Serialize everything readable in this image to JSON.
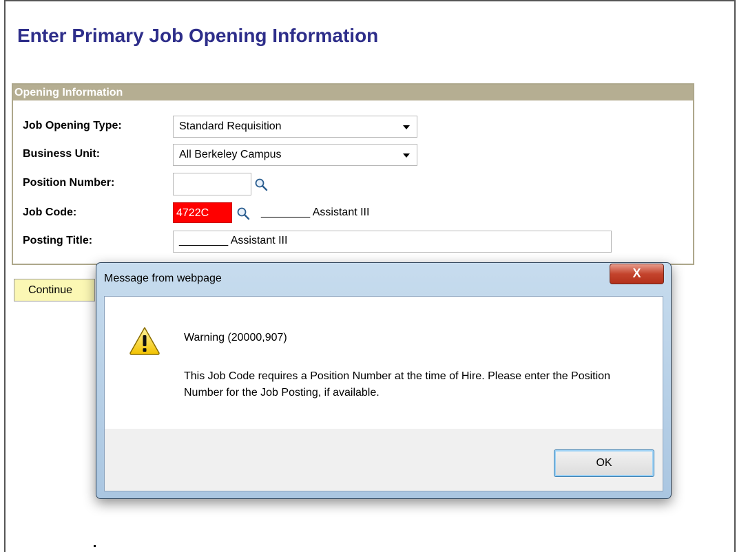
{
  "page": {
    "title": "Enter Primary Job Opening Information"
  },
  "section": {
    "header": "Opening Information",
    "fields": {
      "job_opening_type": {
        "label": "Job Opening Type:",
        "value": "Standard Requisition"
      },
      "business_unit": {
        "label": "Business Unit:",
        "value": "All Berkeley Campus"
      },
      "position_number": {
        "label": "Position Number:",
        "value": ""
      },
      "job_code": {
        "label": "Job Code:",
        "value": "4722C",
        "description": "________ Assistant III"
      },
      "posting_title": {
        "label": "Posting Title:",
        "value": "________ Assistant III"
      }
    }
  },
  "buttons": {
    "continue": "Continue"
  },
  "dialog": {
    "title": "Message from webpage",
    "close_label": "X",
    "heading": "Warning (20000,907)",
    "message": "This Job Code requires a Position Number at the time of Hire.  Please enter the Position Number for the Job Posting, if available.",
    "ok": "OK",
    "icon": "warning-icon"
  },
  "colors": {
    "title": "#2e2e8a",
    "section_header_bg": "#b5ae92",
    "error_field": "#ff0000",
    "continue_bg": "#fbf7b4"
  }
}
